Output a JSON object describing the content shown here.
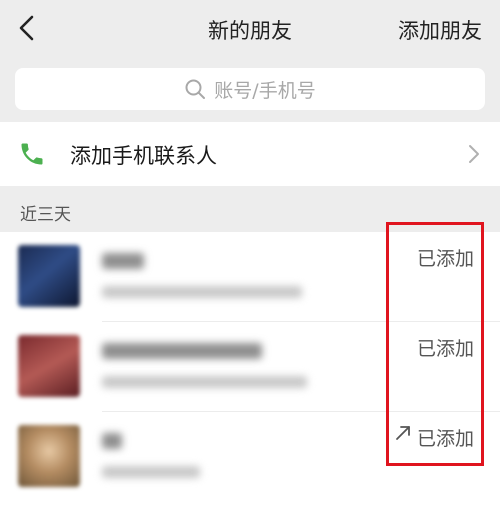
{
  "header": {
    "title": "新的朋友",
    "action_label": "添加朋友"
  },
  "search": {
    "placeholder": "账号/手机号"
  },
  "phone_contacts": {
    "label": "添加手机联系人"
  },
  "section_label": "近三天",
  "requests": [
    {
      "status": "已添加",
      "has_share_icon": false
    },
    {
      "status": "已添加",
      "has_share_icon": false
    },
    {
      "status": "已添加",
      "has_share_icon": true
    }
  ],
  "colors": {
    "background": "#ededed",
    "phone_icon": "#4cb050",
    "highlight_box": "#e0141e"
  },
  "icons": {
    "back": "chevron-left-icon",
    "search": "search-icon",
    "phone": "phone-icon",
    "row_chevron": "chevron-right-icon",
    "share": "arrow-up-right-icon"
  }
}
